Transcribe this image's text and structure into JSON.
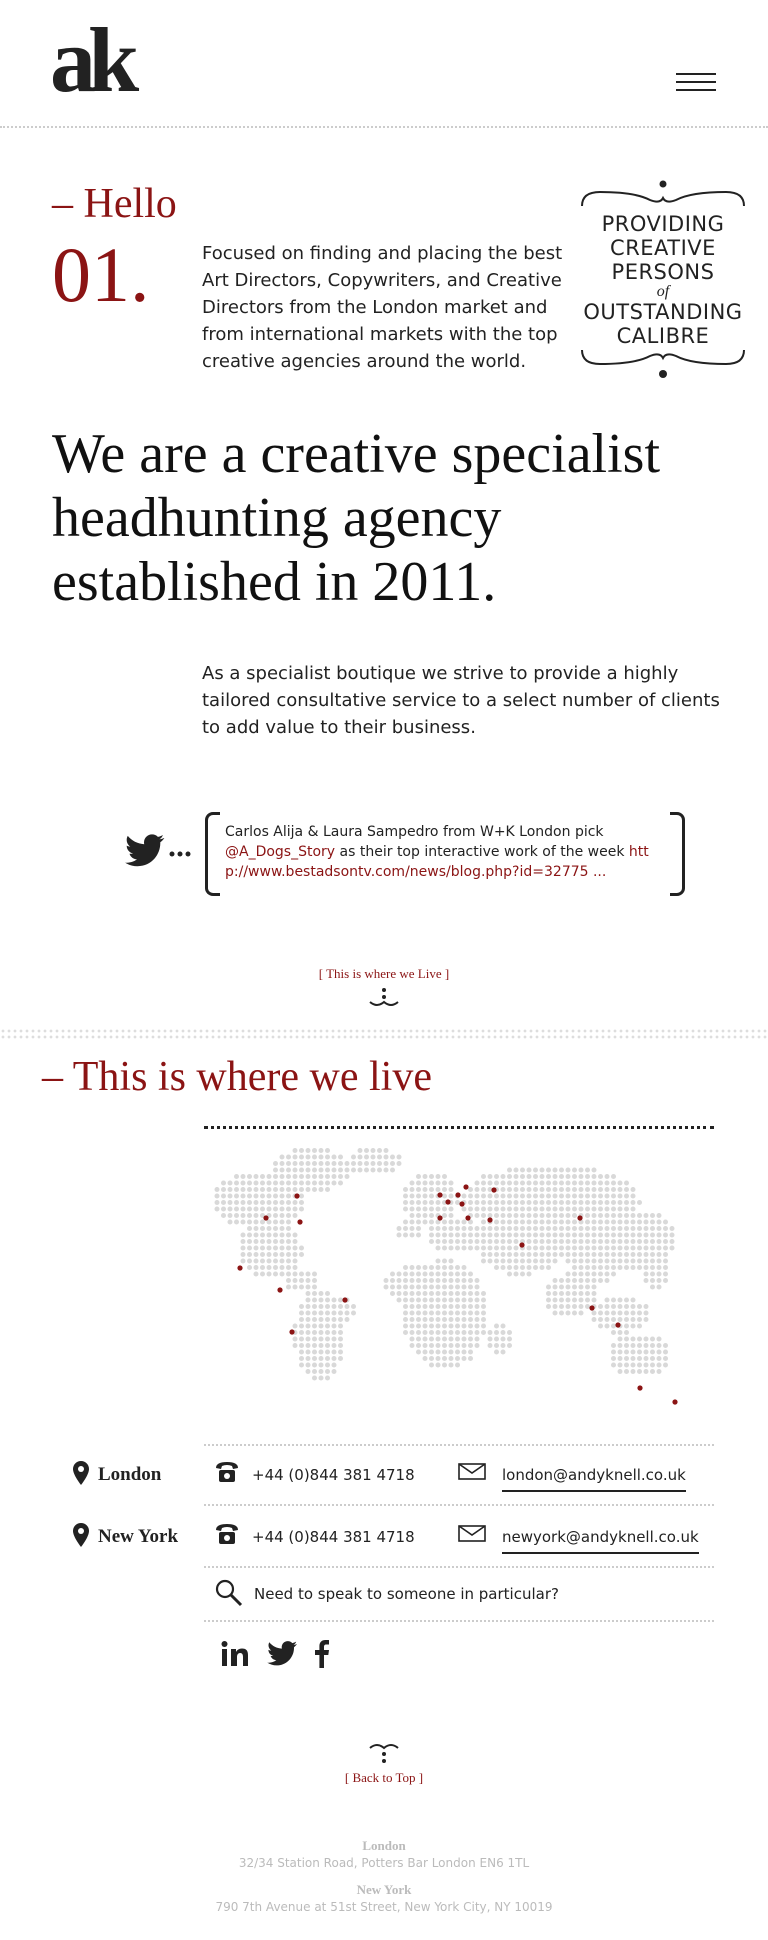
{
  "header": {
    "logo": "ak",
    "menu_icon": "hamburger-icon"
  },
  "intro": {
    "hello": "– Hello",
    "number": "01.",
    "text": "Focused on finding and placing the best Art Directors, Copywriters, and Creative Directors from the London market and from international markets with the top creative agencies around the world."
  },
  "badge": {
    "line1": "PROVIDING",
    "line2": "CREATIVE",
    "line3": "PERSONS",
    "of": "of",
    "line4": "OUTSTANDING",
    "line5": "CALIBRE"
  },
  "headline": "We are a creative specialist headhunting agency established in 2011.",
  "paragraph": "As a specialist boutique we strive to provide a highly tailored consultative service to a select number of clients to add value to their business.",
  "tweet": {
    "text_before": "Carlos Alija & Laura Sampedro from W+K London pick ",
    "handle": "@A_Dogs_Story",
    "text_middle": " as their top interactive work of the week ",
    "link": "http://www.bestadsontv.com/news/blog.php?id=32775 ..."
  },
  "where_link": "[ This is where we Live ]",
  "live_heading": "– This is where we live",
  "colors": {
    "accent": "#8b1414",
    "text": "#222222",
    "map_dot": "#d9d9d9"
  },
  "offices": [
    {
      "city": "London",
      "phone": "+44 (0)844 381 4718",
      "email": "london@andyknell.co.uk"
    },
    {
      "city": "New York",
      "phone": "+44 (0)844 381 4718",
      "email": "newyork@andyknell.co.uk"
    }
  ],
  "speak": "Need to speak to someone in particular?",
  "social": {
    "icons": [
      "linkedin-icon",
      "twitter-icon",
      "facebook-icon"
    ]
  },
  "back_to_top": "[ Back to Top ]",
  "footer": {
    "london_title": "London",
    "london_address": "32/34 Station Road, Potters Bar  London EN6 1TL",
    "ny_title": "New York",
    "ny_address": "790 7th Avenue at 51st Street, New York City, NY 10019"
  }
}
